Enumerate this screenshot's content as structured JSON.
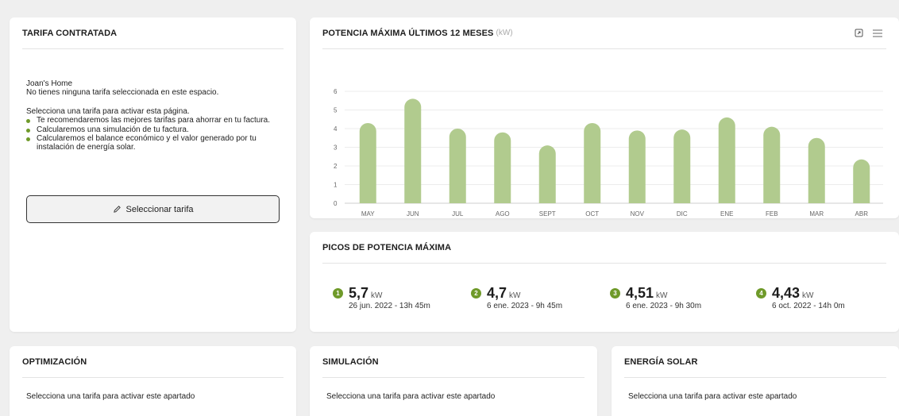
{
  "tarifa": {
    "title": "TARIFA CONTRATADA",
    "home_name": "Joan's Home",
    "no_tarifa": "No tienes ninguna tarifa seleccionada en este espacio.",
    "intro": "Selecciona una tarifa para activar esta página.",
    "bullets": [
      "Te recomendaremos las mejores tarifas para ahorrar en tu factura.",
      "Calcularemos una simulación de tu factura.",
      "Calcularemos el balance económico y el valor generado por tu instalación de energía solar."
    ],
    "button_label": "Seleccionar tarifa"
  },
  "chart": {
    "title": "POTENCIA MÁXIMA ÚLTIMOS 12 MESES",
    "unit": "(kW)",
    "icons": [
      "expand-icon",
      "menu-icon"
    ]
  },
  "chart_data": {
    "type": "bar",
    "categories": [
      "MAY",
      "JUN",
      "JUL",
      "AGO",
      "SEPT",
      "OCT",
      "NOV",
      "DIC",
      "ENE",
      "FEB",
      "MAR",
      "ABR"
    ],
    "values": [
      4.3,
      5.6,
      4.0,
      3.8,
      3.1,
      4.3,
      3.9,
      3.95,
      4.6,
      4.1,
      3.5,
      2.35
    ],
    "yticks": [
      "0",
      "1",
      "2",
      "3",
      "4",
      "5",
      "6"
    ],
    "ylim": [
      0,
      6
    ],
    "color": "#b1cb8e",
    "grid": true
  },
  "picos": {
    "title": "PICOS DE POTENCIA MÁXIMA",
    "unit": "kW",
    "items": [
      {
        "rank": "1",
        "value": "5,7",
        "date": "26 jun. 2022 - 13h 45m"
      },
      {
        "rank": "2",
        "value": "4,7",
        "date": "6 ene. 2023 - 9h 45m"
      },
      {
        "rank": "3",
        "value": "4,51",
        "date": "6 ene. 2023 - 9h 30m"
      },
      {
        "rank": "4",
        "value": "4,43",
        "date": "6 oct. 2022 - 14h 0m"
      }
    ]
  },
  "optimizacion": {
    "title": "OPTIMIZACIÓN",
    "text": "Selecciona una tarifa para activar este apartado"
  },
  "simulacion": {
    "title": "SIMULACIÓN",
    "text": "Selecciona una tarifa para activar este apartado"
  },
  "energia_solar": {
    "title": "ENERGÍA SOLAR",
    "text": "Selecciona una tarifa para activar este apartado"
  },
  "colors": {
    "accent": "#6f9a2a",
    "bar": "#b1cb8e",
    "background": "#efefef"
  }
}
